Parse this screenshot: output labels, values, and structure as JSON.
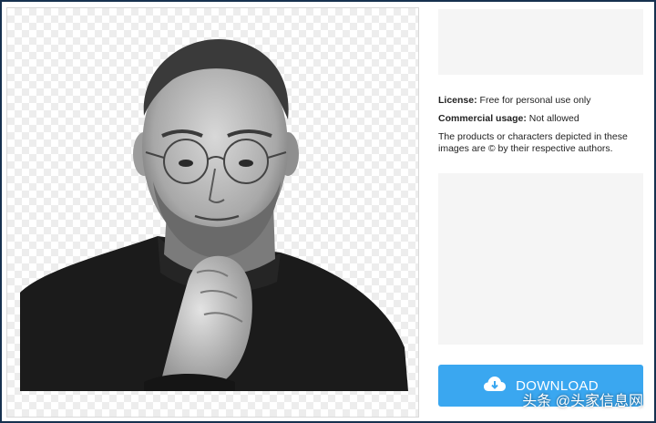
{
  "license": {
    "label": "License:",
    "value": "Free for personal use only"
  },
  "commercial": {
    "label": "Commercial usage:",
    "value": "Not allowed"
  },
  "disclaimer": "The products or characters depicted in these images are © by their respective authors.",
  "download": {
    "label": "DOWNLOAD",
    "icon": "cloud-download-icon"
  },
  "watermark": "头条 @头家信息网",
  "colors": {
    "accent": "#3aa7f0",
    "frame": "#16314f",
    "ad_bg": "#f5f5f5"
  }
}
